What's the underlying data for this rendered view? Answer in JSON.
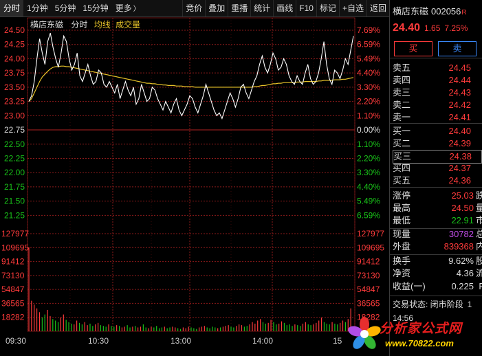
{
  "toolbar": {
    "tabs": [
      "分时",
      "1分钟",
      "5分钟",
      "15分钟",
      "更多"
    ],
    "more_chevron": "〉",
    "buttons": [
      "竞价",
      "叠加",
      "重播",
      "统计",
      "画线",
      "F10",
      "标记",
      "+自选",
      "返回"
    ]
  },
  "legend": {
    "name": "横店东磁",
    "mode": "分时",
    "avg": "均线",
    "vol": "成交量"
  },
  "colors": {
    "up": "#ff3b3b",
    "down": "#19c219",
    "neutral": "#dddddd",
    "avg": "#e6c229",
    "grid": "#8b1a1a"
  },
  "chart_data": {
    "type": "line",
    "price_axis_left": [
      "24.50",
      "24.25",
      "24.00",
      "23.75",
      "23.50",
      "23.25",
      "23.00",
      "22.75",
      "22.50",
      "22.25",
      "22.00",
      "21.75",
      "21.50",
      "21.25"
    ],
    "pct_axis_right": [
      "7.69%",
      "6.59%",
      "5.49%",
      "4.40%",
      "3.30%",
      "2.20%",
      "1.10%",
      "0.00%",
      "1.10%",
      "2.20%",
      "3.30%",
      "4.40%",
      "5.49%",
      "6.59%"
    ],
    "volume_axis": [
      "127977",
      "109695",
      "91412",
      "73130",
      "54847",
      "36565",
      "18282"
    ],
    "time_labels": [
      "09:30",
      "10:30",
      "13:00",
      "14:00",
      "15"
    ],
    "prev_close": 22.75,
    "ylim": [
      21.17,
      24.5
    ],
    "price": [
      23.25,
      23.35,
      23.6,
      24.0,
      24.35,
      24.1,
      23.9,
      24.3,
      24.45,
      24.2,
      24.0,
      23.85,
      24.1,
      24.4,
      24.3,
      24.0,
      23.8,
      23.9,
      24.1,
      23.7,
      23.6,
      23.75,
      23.9,
      23.7,
      23.55,
      23.6,
      23.8,
      23.75,
      23.55,
      23.5,
      23.6,
      23.5,
      23.4,
      23.55,
      23.3,
      23.45,
      23.6,
      23.45,
      23.35,
      23.5,
      23.2,
      23.3,
      23.55,
      23.4,
      23.25,
      23.3,
      23.5,
      23.45,
      23.3,
      23.2,
      23.1,
      23.25,
      23.15,
      23.05,
      23.2,
      23.3,
      23.1,
      23.0,
      23.1,
      23.2,
      23.35,
      23.3,
      23.15,
      23.05,
      23.2,
      23.35,
      23.55,
      23.4,
      23.25,
      23.1,
      23.0,
      23.05,
      22.95,
      23.1,
      23.25,
      23.4,
      23.3,
      23.15,
      23.3,
      23.5,
      23.55,
      23.4,
      23.3,
      23.45,
      23.6,
      23.7,
      23.9,
      24.05,
      23.85,
      23.75,
      23.9,
      24.1,
      24.0,
      23.8,
      23.85,
      24.0,
      23.9,
      23.7,
      23.6,
      23.55,
      23.7,
      23.6,
      23.55,
      23.75,
      23.9,
      23.65,
      23.55,
      23.6,
      23.75,
      24.0,
      24.3,
      23.9,
      23.65,
      23.55,
      23.8,
      23.75,
      23.65,
      23.8,
      24.0,
      23.9,
      24.15,
      24.4
    ],
    "avg": [
      23.25,
      23.3,
      23.4,
      23.5,
      23.6,
      23.68,
      23.73,
      23.78,
      23.82,
      23.85,
      23.86,
      23.86,
      23.87,
      23.87,
      23.86,
      23.86,
      23.85,
      23.84,
      23.83,
      23.82,
      23.81,
      23.8,
      23.79,
      23.78,
      23.77,
      23.76,
      23.75,
      23.74,
      23.73,
      23.72,
      23.71,
      23.7,
      23.69,
      23.68,
      23.67,
      23.66,
      23.65,
      23.64,
      23.63,
      23.62,
      23.61,
      23.6,
      23.59,
      23.58,
      23.57,
      23.57,
      23.56,
      23.56,
      23.55,
      23.55,
      23.54,
      23.54,
      23.53,
      23.53,
      23.53,
      23.52,
      23.52,
      23.52,
      23.51,
      23.51,
      23.51,
      23.51,
      23.5,
      23.5,
      23.5,
      23.5,
      23.5,
      23.5,
      23.5,
      23.5,
      23.5,
      23.5,
      23.5,
      23.5,
      23.5,
      23.5,
      23.5,
      23.5,
      23.5,
      23.5,
      23.5,
      23.5,
      23.5,
      23.5,
      23.51,
      23.51,
      23.52,
      23.53,
      23.53,
      23.54,
      23.55,
      23.56,
      23.56,
      23.57,
      23.57,
      23.58,
      23.58,
      23.58,
      23.58,
      23.58,
      23.59,
      23.59,
      23.59,
      23.6,
      23.6,
      23.6,
      23.6,
      23.6,
      23.61,
      23.61,
      23.62,
      23.62,
      23.62,
      23.62,
      23.63,
      23.63,
      23.63,
      23.64,
      23.64,
      23.65,
      23.66,
      23.67
    ],
    "volume": [
      110000,
      40000,
      35000,
      30000,
      25000,
      18000,
      22000,
      28000,
      20000,
      16000,
      14000,
      12000,
      18000,
      22000,
      15000,
      12000,
      10000,
      9000,
      14000,
      11000,
      9000,
      12000,
      8000,
      10000,
      7000,
      9000,
      11000,
      8000,
      7000,
      6000,
      9000,
      7000,
      6000,
      8000,
      7000,
      5000,
      6000,
      8000,
      5000,
      6000,
      7000,
      5000,
      6000,
      9000,
      5000,
      4000,
      6000,
      5000,
      7000,
      4000,
      5000,
      6000,
      4000,
      5000,
      6000,
      5000,
      4000,
      3000,
      5000,
      4000,
      6000,
      5000,
      4000,
      3000,
      5000,
      6000,
      7000,
      5000,
      4000,
      6000,
      5000,
      4000,
      5000,
      6000,
      7000,
      8000,
      6000,
      5000,
      7000,
      9000,
      8000,
      6000,
      7000,
      9000,
      12000,
      10000,
      14000,
      16000,
      12000,
      10000,
      11000,
      15000,
      12000,
      9000,
      10000,
      13000,
      11000,
      8000,
      9000,
      7000,
      9000,
      8000,
      7000,
      10000,
      12000,
      9000,
      8000,
      9000,
      11000,
      14000,
      18000,
      12000,
      10000,
      9000,
      12000,
      10000,
      9000,
      11000,
      14000,
      12000,
      16000,
      30000
    ]
  },
  "panel": {
    "name": "横店东磁",
    "code": "002056",
    "code_flag": "R",
    "price": "24.40",
    "change": "1.65",
    "pct": "7.25%",
    "buy_label": "买",
    "sell_label": "卖",
    "asks": [
      {
        "label": "卖五",
        "price": "24.45"
      },
      {
        "label": "卖四",
        "price": "24.44"
      },
      {
        "label": "卖三",
        "price": "24.43"
      },
      {
        "label": "卖二",
        "price": "24.42"
      },
      {
        "label": "卖一",
        "price": "24.41"
      }
    ],
    "bids": [
      {
        "label": "买一",
        "price": "24.40"
      },
      {
        "label": "买二",
        "price": "24.39"
      },
      {
        "label": "买三",
        "price": "24.38"
      },
      {
        "label": "买四",
        "price": "24.37"
      },
      {
        "label": "买五",
        "price": "24.36"
      }
    ],
    "stats1": [
      {
        "label": "涨停",
        "value": "25.03",
        "cut": "跌"
      },
      {
        "label": "最高",
        "value": "24.50",
        "cut": "量"
      },
      {
        "label": "最低",
        "value": "22.91",
        "cut": "市"
      }
    ],
    "stats2": [
      {
        "label": "现量",
        "value": "30782",
        "cut": "总"
      },
      {
        "label": "外盘",
        "value": "839368",
        "cut": "内"
      }
    ],
    "stats3": [
      {
        "label": "换手",
        "value": "9.62%",
        "cut": "股"
      },
      {
        "label": "净资",
        "value": "4.36",
        "cut": "流"
      },
      {
        "label": "收益(一)",
        "value": "0.225",
        "cut": "P"
      }
    ],
    "status": "交易状态: 闭市阶段",
    "status_cut": "1",
    "tick": "14:56"
  },
  "watermark": {
    "site_name": "分析家公式网",
    "url": "www.70822.com"
  }
}
